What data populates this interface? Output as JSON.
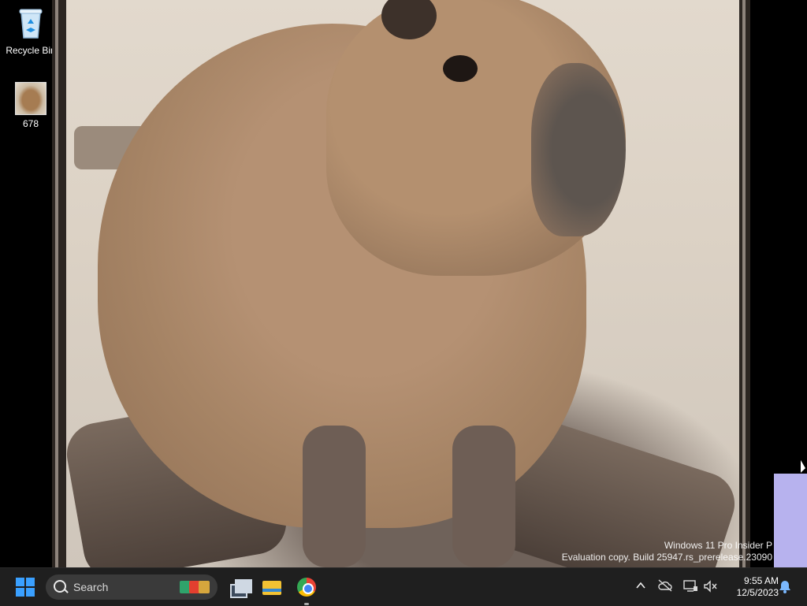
{
  "desktop": {
    "icons": [
      {
        "label": "Recycle Bin",
        "icon": "recycle-bin-icon"
      },
      {
        "label": "678",
        "icon": "image-file-icon"
      }
    ]
  },
  "watermark": {
    "line1": "Windows 11 Pro Insider P",
    "line2": "Evaluation copy. Build 25947.rs_prerelease.23090"
  },
  "taskbar": {
    "search_placeholder": "Search",
    "clock_time": "9:55 AM",
    "clock_date": "12/5/2023",
    "apps": [
      "task-view-icon",
      "file-explorer-icon",
      "chrome-icon"
    ]
  },
  "colors": {
    "taskbar_bg": "#1f1f1f",
    "start_blue": "#3aa0ff",
    "lavender_block": "#b7b2ee"
  }
}
